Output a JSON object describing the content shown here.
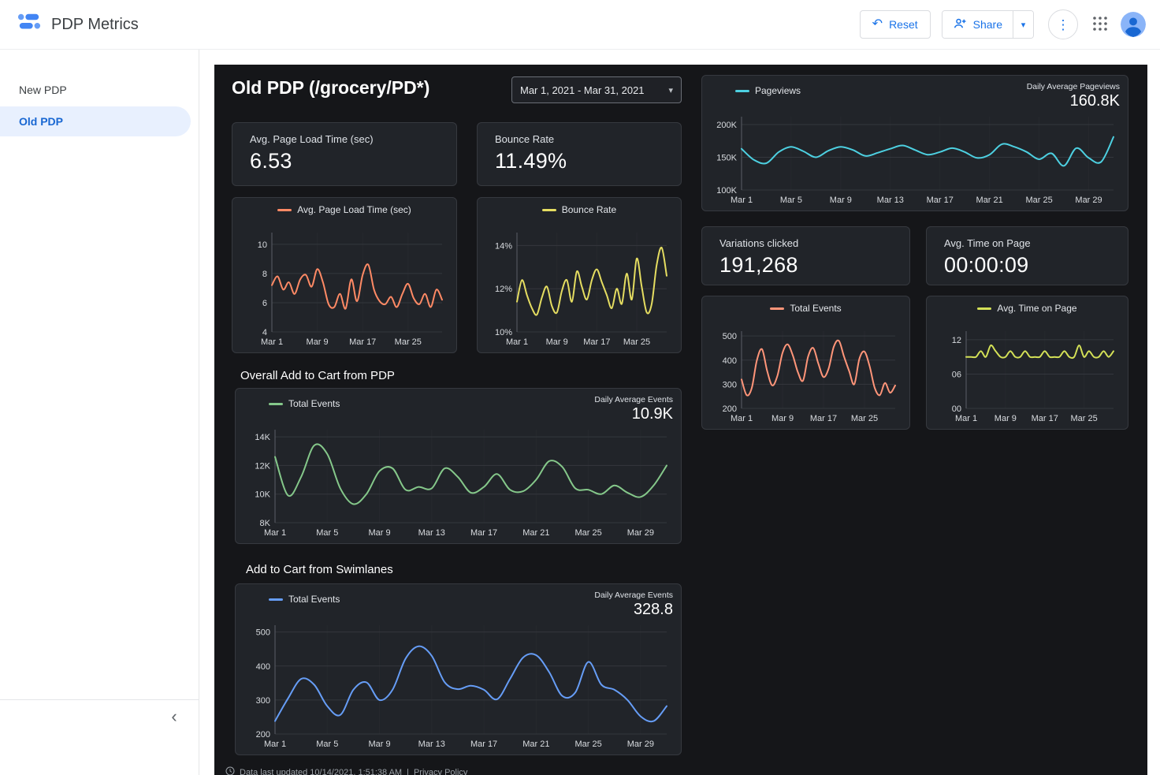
{
  "header": {
    "app_title": "PDP Metrics",
    "reset_label": "Reset",
    "share_label": "Share"
  },
  "icons": {
    "undo": "↶",
    "chevron_down": "▾",
    "more_vert": "⋮",
    "collapse": "‹"
  },
  "sidebar": {
    "items": [
      {
        "label": "New PDP",
        "selected": false
      },
      {
        "label": "Old PDP",
        "selected": true
      }
    ]
  },
  "page": {
    "title": "Old PDP (/grocery/PD*)",
    "date_range": "Mar 1, 2021 - Mar 31, 2021",
    "sections": {
      "overall_add_to_cart": "Overall Add to Cart from PDP",
      "swimlanes": "Add to Cart from Swimlanes"
    },
    "scorecards": [
      {
        "label": "Avg. Page Load Time (sec)",
        "value": "6.53"
      },
      {
        "label": "Bounce Rate",
        "value": "11.49%"
      },
      {
        "label": "Variations clicked",
        "value": "191,268"
      },
      {
        "label": "Avg. Time on Page",
        "value": "00:00:09"
      }
    ],
    "footer": {
      "updated": "Data last updated 10/14/2021, 1:51:38 AM",
      "separator": "|",
      "privacy": "Privacy Policy"
    }
  },
  "chart_data": [
    {
      "id": "pageviews",
      "type": "line",
      "title": "",
      "series_label": "Pageviews",
      "color": "#4dd0e1",
      "corner_title": "Daily Average Pageviews",
      "corner_value": "160.8K",
      "xlabel": "",
      "ylabel": "",
      "ylim": [
        100000,
        212000
      ],
      "yticks": [
        {
          "v": 100000,
          "label": "100K"
        },
        {
          "v": 150000,
          "label": "150K"
        },
        {
          "v": 200000,
          "label": "200K"
        }
      ],
      "xticks": [
        {
          "i": 0,
          "label": "Mar 1"
        },
        {
          "i": 4,
          "label": "Mar 5"
        },
        {
          "i": 8,
          "label": "Mar 9"
        },
        {
          "i": 12,
          "label": "Mar 13"
        },
        {
          "i": 16,
          "label": "Mar 17"
        },
        {
          "i": 20,
          "label": "Mar 21"
        },
        {
          "i": 24,
          "label": "Mar 25"
        },
        {
          "i": 28,
          "label": "Mar 29"
        }
      ],
      "values": [
        163000,
        146000,
        141000,
        158000,
        166000,
        159000,
        150000,
        160000,
        166000,
        161000,
        152000,
        157000,
        163000,
        168000,
        161000,
        154000,
        158000,
        164000,
        158000,
        149000,
        154000,
        170000,
        166000,
        158000,
        147000,
        156000,
        137000,
        164000,
        149000,
        143000,
        181000
      ]
    },
    {
      "id": "avg_page_load",
      "type": "line",
      "title": "",
      "series_label": "Avg. Page Load Time (sec)",
      "color": "#ff8a65",
      "xlabel": "",
      "ylabel": "",
      "ylim": [
        4,
        10.8
      ],
      "yticks": [
        {
          "v": 4,
          "label": "4"
        },
        {
          "v": 6,
          "label": "6"
        },
        {
          "v": 8,
          "label": "8"
        },
        {
          "v": 10,
          "label": "10"
        }
      ],
      "xticks": [
        {
          "i": 0,
          "label": "Mar 1"
        },
        {
          "i": 8,
          "label": "Mar 9"
        },
        {
          "i": 16,
          "label": "Mar 17"
        },
        {
          "i": 24,
          "label": "Mar 25"
        }
      ],
      "values": [
        7.2,
        7.8,
        6.9,
        7.4,
        6.6,
        7.6,
        7.9,
        7.1,
        8.3,
        7.4,
        5.9,
        5.7,
        6.6,
        5.6,
        7.6,
        6.1,
        7.9,
        8.6,
        6.9,
        6.1,
        5.9,
        6.4,
        5.7,
        6.6,
        7.3,
        6.3,
        5.9,
        6.6,
        5.7,
        6.9,
        6.2
      ]
    },
    {
      "id": "bounce_rate",
      "type": "line",
      "title": "",
      "series_label": "Bounce Rate",
      "color": "#e5dd61",
      "xlabel": "",
      "ylabel": "",
      "ylim": [
        10,
        14.6
      ],
      "yticks": [
        {
          "v": 10,
          "label": "10%"
        },
        {
          "v": 12,
          "label": "12%"
        },
        {
          "v": 14,
          "label": "14%"
        }
      ],
      "xticks": [
        {
          "i": 0,
          "label": "Mar 1"
        },
        {
          "i": 8,
          "label": "Mar 9"
        },
        {
          "i": 16,
          "label": "Mar 17"
        },
        {
          "i": 24,
          "label": "Mar 25"
        }
      ],
      "values": [
        11.4,
        12.4,
        11.7,
        11.1,
        10.8,
        11.6,
        12.1,
        11.2,
        10.9,
        11.9,
        12.4,
        11.4,
        12.8,
        12.1,
        11.5,
        12.4,
        12.9,
        12.3,
        11.7,
        11.1,
        12.0,
        11.3,
        12.7,
        11.5,
        13.4,
        12.1,
        10.9,
        11.3,
        13.1,
        13.9,
        12.6
      ]
    },
    {
      "id": "total_events",
      "type": "line",
      "title": "",
      "series_label": "Total Events",
      "color": "#ff9579",
      "xlabel": "",
      "ylabel": "",
      "ylim": [
        200,
        520
      ],
      "yticks": [
        {
          "v": 200,
          "label": "200"
        },
        {
          "v": 300,
          "label": "300"
        },
        {
          "v": 400,
          "label": "400"
        },
        {
          "v": 500,
          "label": "500"
        }
      ],
      "xticks": [
        {
          "i": 0,
          "label": "Mar 1"
        },
        {
          "i": 8,
          "label": "Mar 9"
        },
        {
          "i": 16,
          "label": "Mar 17"
        },
        {
          "i": 24,
          "label": "Mar 25"
        }
      ],
      "values": [
        320,
        255,
        285,
        400,
        445,
        355,
        295,
        335,
        430,
        465,
        420,
        350,
        315,
        415,
        450,
        385,
        330,
        365,
        455,
        480,
        415,
        355,
        300,
        405,
        435,
        375,
        285,
        255,
        305,
        265,
        295
      ]
    },
    {
      "id": "avg_time_on_page",
      "type": "line",
      "title": "",
      "series_label": "Avg. Time on Page",
      "color": "#d4e157",
      "xlabel": "",
      "ylabel": "",
      "ylim": [
        0,
        13.5
      ],
      "yticks": [
        {
          "v": 0,
          "label": "00"
        },
        {
          "v": 6,
          "label": "06"
        },
        {
          "v": 12,
          "label": "12"
        }
      ],
      "xticks": [
        {
          "i": 0,
          "label": "Mar 1"
        },
        {
          "i": 8,
          "label": "Mar 9"
        },
        {
          "i": 16,
          "label": "Mar 17"
        },
        {
          "i": 24,
          "label": "Mar 25"
        }
      ],
      "values": [
        9,
        9,
        9,
        10,
        9,
        11,
        10,
        9,
        9,
        10,
        9,
        9,
        10,
        9,
        9,
        9,
        10,
        9,
        9,
        9,
        10,
        9,
        9,
        11,
        9,
        10,
        9,
        9,
        10,
        9,
        10
      ]
    },
    {
      "id": "overall_add_to_cart",
      "type": "line",
      "title": "Overall Add to Cart from PDP",
      "series_label": "Total Events",
      "color": "#85c88a",
      "corner_title": "Daily Average Events",
      "corner_value": "10.9K",
      "xlabel": "",
      "ylabel": "",
      "ylim": [
        8000,
        14500
      ],
      "yticks": [
        {
          "v": 8000,
          "label": "8K"
        },
        {
          "v": 10000,
          "label": "10K"
        },
        {
          "v": 12000,
          "label": "12K"
        },
        {
          "v": 14000,
          "label": "14K"
        }
      ],
      "xticks": [
        {
          "i": 0,
          "label": "Mar 1"
        },
        {
          "i": 4,
          "label": "Mar 5"
        },
        {
          "i": 8,
          "label": "Mar 9"
        },
        {
          "i": 12,
          "label": "Mar 13"
        },
        {
          "i": 16,
          "label": "Mar 17"
        },
        {
          "i": 20,
          "label": "Mar 21"
        },
        {
          "i": 24,
          "label": "Mar 25"
        },
        {
          "i": 28,
          "label": "Mar 29"
        }
      ],
      "values": [
        12600,
        9900,
        11200,
        13400,
        12800,
        10400,
        9300,
        10000,
        11600,
        11800,
        10300,
        10500,
        10400,
        11800,
        11200,
        10100,
        10500,
        11400,
        10300,
        10200,
        11000,
        12300,
        11900,
        10400,
        10300,
        10000,
        10600,
        10100,
        9800,
        10600,
        12000
      ]
    },
    {
      "id": "swimlanes",
      "type": "line",
      "title": "Add to Cart from Swimlanes",
      "series_label": "Total Events",
      "color": "#669df6",
      "corner_title": "Daily Average Events",
      "corner_value": "328.8",
      "xlabel": "",
      "ylabel": "",
      "ylim": [
        200,
        520
      ],
      "yticks": [
        {
          "v": 200,
          "label": "200"
        },
        {
          "v": 300,
          "label": "300"
        },
        {
          "v": 400,
          "label": "400"
        },
        {
          "v": 500,
          "label": "500"
        }
      ],
      "xticks": [
        {
          "i": 0,
          "label": "Mar 1"
        },
        {
          "i": 4,
          "label": "Mar 5"
        },
        {
          "i": 8,
          "label": "Mar 9"
        },
        {
          "i": 12,
          "label": "Mar 13"
        },
        {
          "i": 16,
          "label": "Mar 17"
        },
        {
          "i": 20,
          "label": "Mar 21"
        },
        {
          "i": 24,
          "label": "Mar 25"
        },
        {
          "i": 28,
          "label": "Mar 29"
        }
      ],
      "values": [
        238,
        305,
        362,
        345,
        282,
        256,
        330,
        352,
        300,
        330,
        422,
        458,
        430,
        352,
        332,
        342,
        330,
        302,
        362,
        425,
        432,
        382,
        312,
        322,
        412,
        345,
        330,
        300,
        252,
        238,
        282
      ]
    }
  ]
}
